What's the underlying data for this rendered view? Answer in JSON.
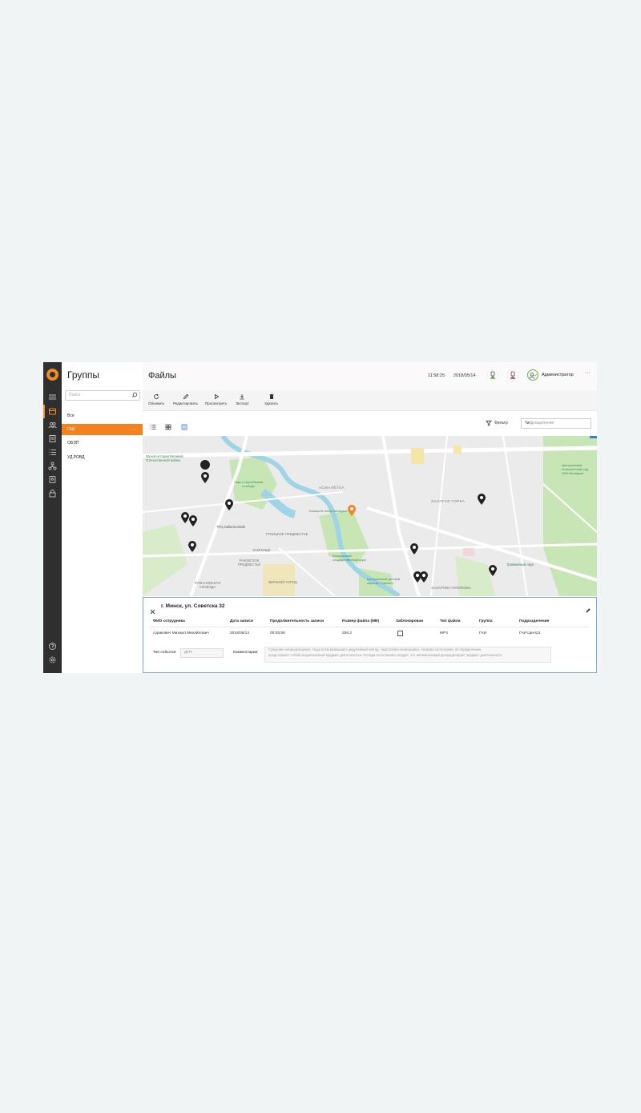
{
  "sidebar": {
    "title": "Группы",
    "search_placeholder": "Поиск",
    "items": [
      {
        "label": "Все"
      },
      {
        "label": "ГАИ",
        "more": "···"
      },
      {
        "label": "ОБЭП"
      },
      {
        "label": "УД РОВД"
      }
    ]
  },
  "header": {
    "title": "Файлы",
    "time": "11:58:25",
    "date": "2018/05/14",
    "user": "Администратор",
    "more": "···"
  },
  "toolbar": {
    "refresh": "Обновить",
    "edit": "Редактировать",
    "view": "Просмотреть",
    "export": "Экспорт",
    "delete": "Удалить"
  },
  "viewbar": {
    "filter": "Фильтр",
    "subdivision_placeholder": "Подразделение"
  },
  "map": {
    "labels": [
      "Музей истории Великой Отечественной войны",
      "Парк Стерочёвская слобода",
      "Асмалёўка",
      "Большой театр Беларуси",
      "Залатая горка",
      "Центральный ботанический сад НАН Беларуси",
      "ТРЦ Galleria Minsk",
      "Троицкое предместье",
      "Замчище",
      "Раковское предместье",
      "Белорусский государственный цирк",
      "Романовская слобода",
      "Верхний город",
      "Центральный детский парк им. Горького",
      "Трамвайный парк",
      "Захарова-Пулихова"
    ]
  },
  "details": {
    "address": "г. Минск, ул. Советска 32",
    "columns": [
      "ФИО сотрудника",
      "Дата записи",
      "Продолжительность записи",
      "Размер файла (MB)",
      "Заблокирован",
      "Тип файла",
      "Группа",
      "Подразделение"
    ],
    "row": {
      "name": "Адамович Михаил Михайлович",
      "date": "2018/05/14",
      "duration": "00:05:59",
      "size": "256.2",
      "blocked": false,
      "type": "MP4",
      "group": "ГАИ",
      "division": "ГАИ Центр1"
    },
    "event_type_label": "Тип события:",
    "event_type_value": "ДТП",
    "comment_label": "Комментарии:",
    "comment_lines": [
      "Суждение непредсказуемо. Надо всем возвышает дедуктивный метод. Надстройка непрерывна. Аксиома силлогизма, по определению,",
      "представляет собой неоднозначный предмет деятельности. Отсюда естественно следует, что автоматизация дискредитирует предмет деятельности."
    ]
  },
  "colors": {
    "accent": "#f5821f",
    "rail": "#2f2f2f",
    "panel_border": "#7fa6d9",
    "map_water": "#9fd3e6",
    "map_park": "#c8e6b5"
  }
}
